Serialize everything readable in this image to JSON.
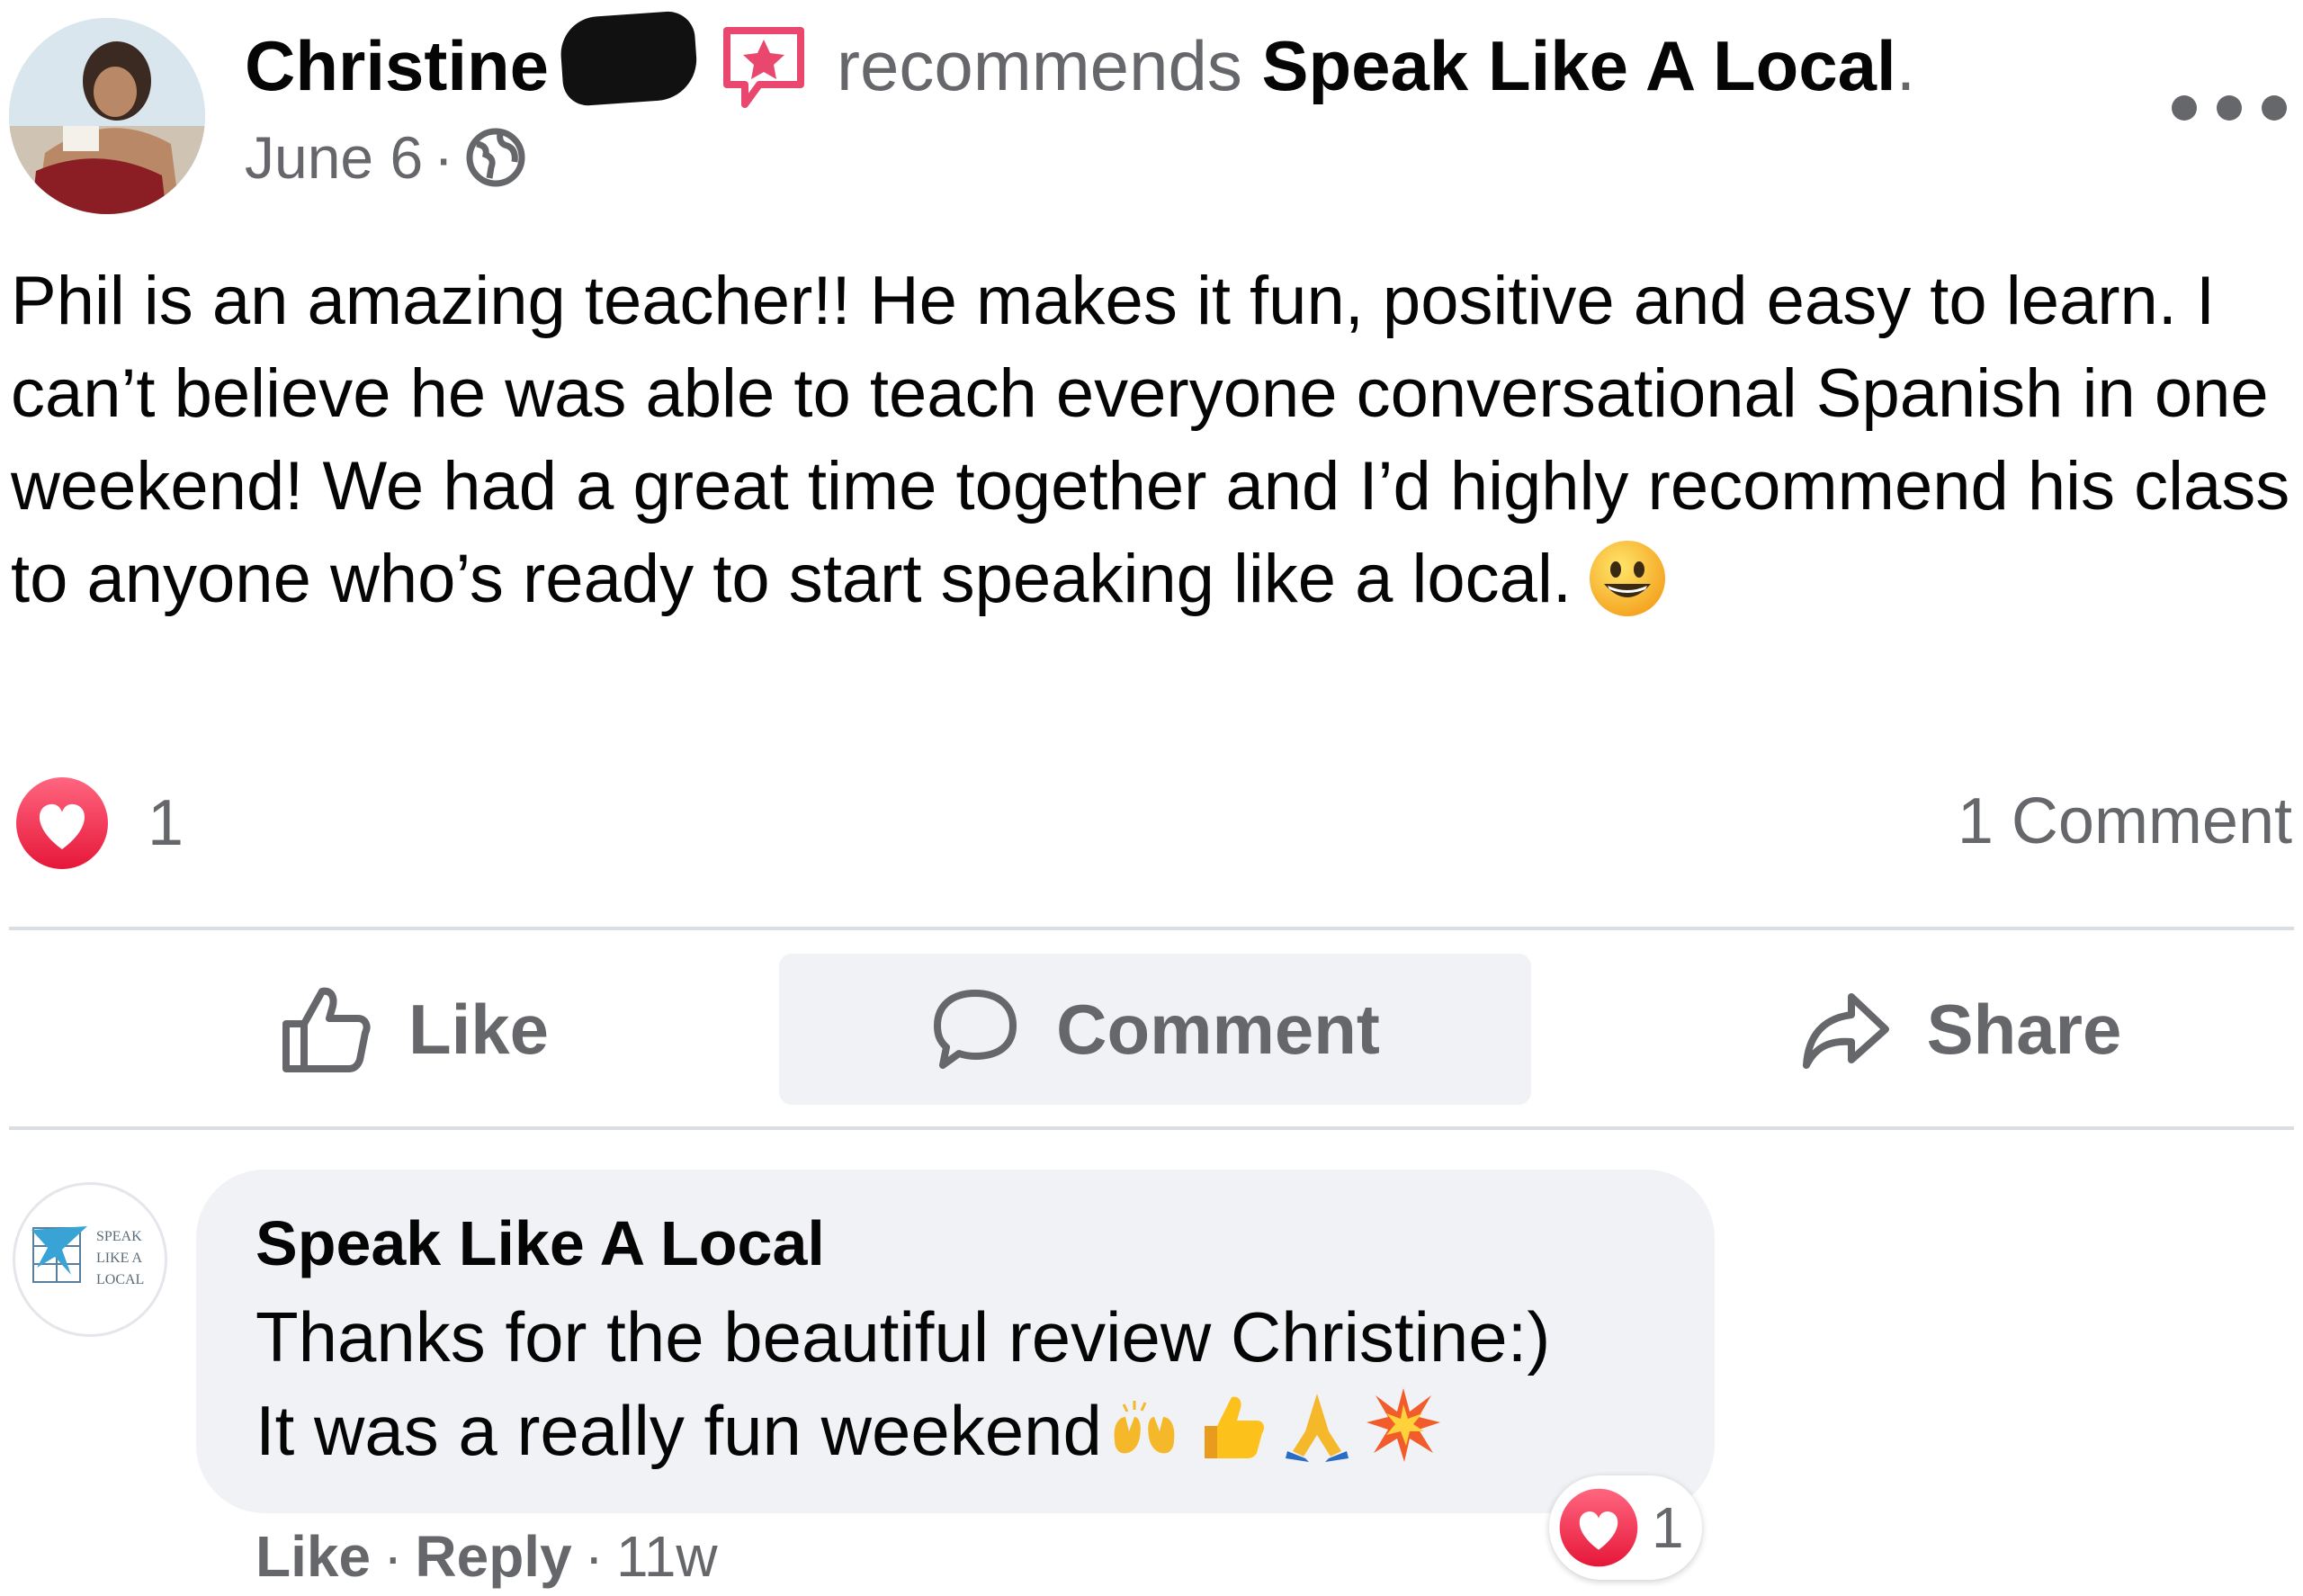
{
  "post": {
    "author": "Christine",
    "recommends_verb": "recommends",
    "page_name": "Speak Like A Local",
    "period": ".",
    "date": "June 6",
    "date_separator": "·",
    "icons": {
      "more": "more-options-icon",
      "privacy": "globe-icon",
      "badge": "recommendation-star-icon"
    },
    "text": "Phil is an amazing teacher!! He makes it fun, positive and easy to learn. I can’t believe he was able to teach everyone conversational Spanish in one weekend! We had a great time together and I’d highly recommend his class to anyone who’s ready to start speaking like a local.",
    "reaction_count": "1",
    "comment_count": "1 Comment"
  },
  "actions": {
    "like": "Like",
    "comment": "Comment",
    "share": "Share"
  },
  "comment": {
    "author": "Speak Like A Local",
    "avatar_text": [
      "SPEAK",
      "LIKE A",
      "LOCAL"
    ],
    "line1": "Thanks for the beautiful review Christine:)",
    "line2": "It was a really fun weekend",
    "emojis": [
      "raising-hands",
      "thumbs-up",
      "folded-hands",
      "collision"
    ],
    "reaction_count": "1",
    "like_label": "Like",
    "reply_label": "Reply",
    "separator": "·",
    "time": "11w"
  },
  "colors": {
    "text": "#050505",
    "secondary": "#65676b",
    "divider": "#dadde1",
    "bubble": "#f0f2f5",
    "love": "#f33e58",
    "badge": "#e9476e"
  }
}
